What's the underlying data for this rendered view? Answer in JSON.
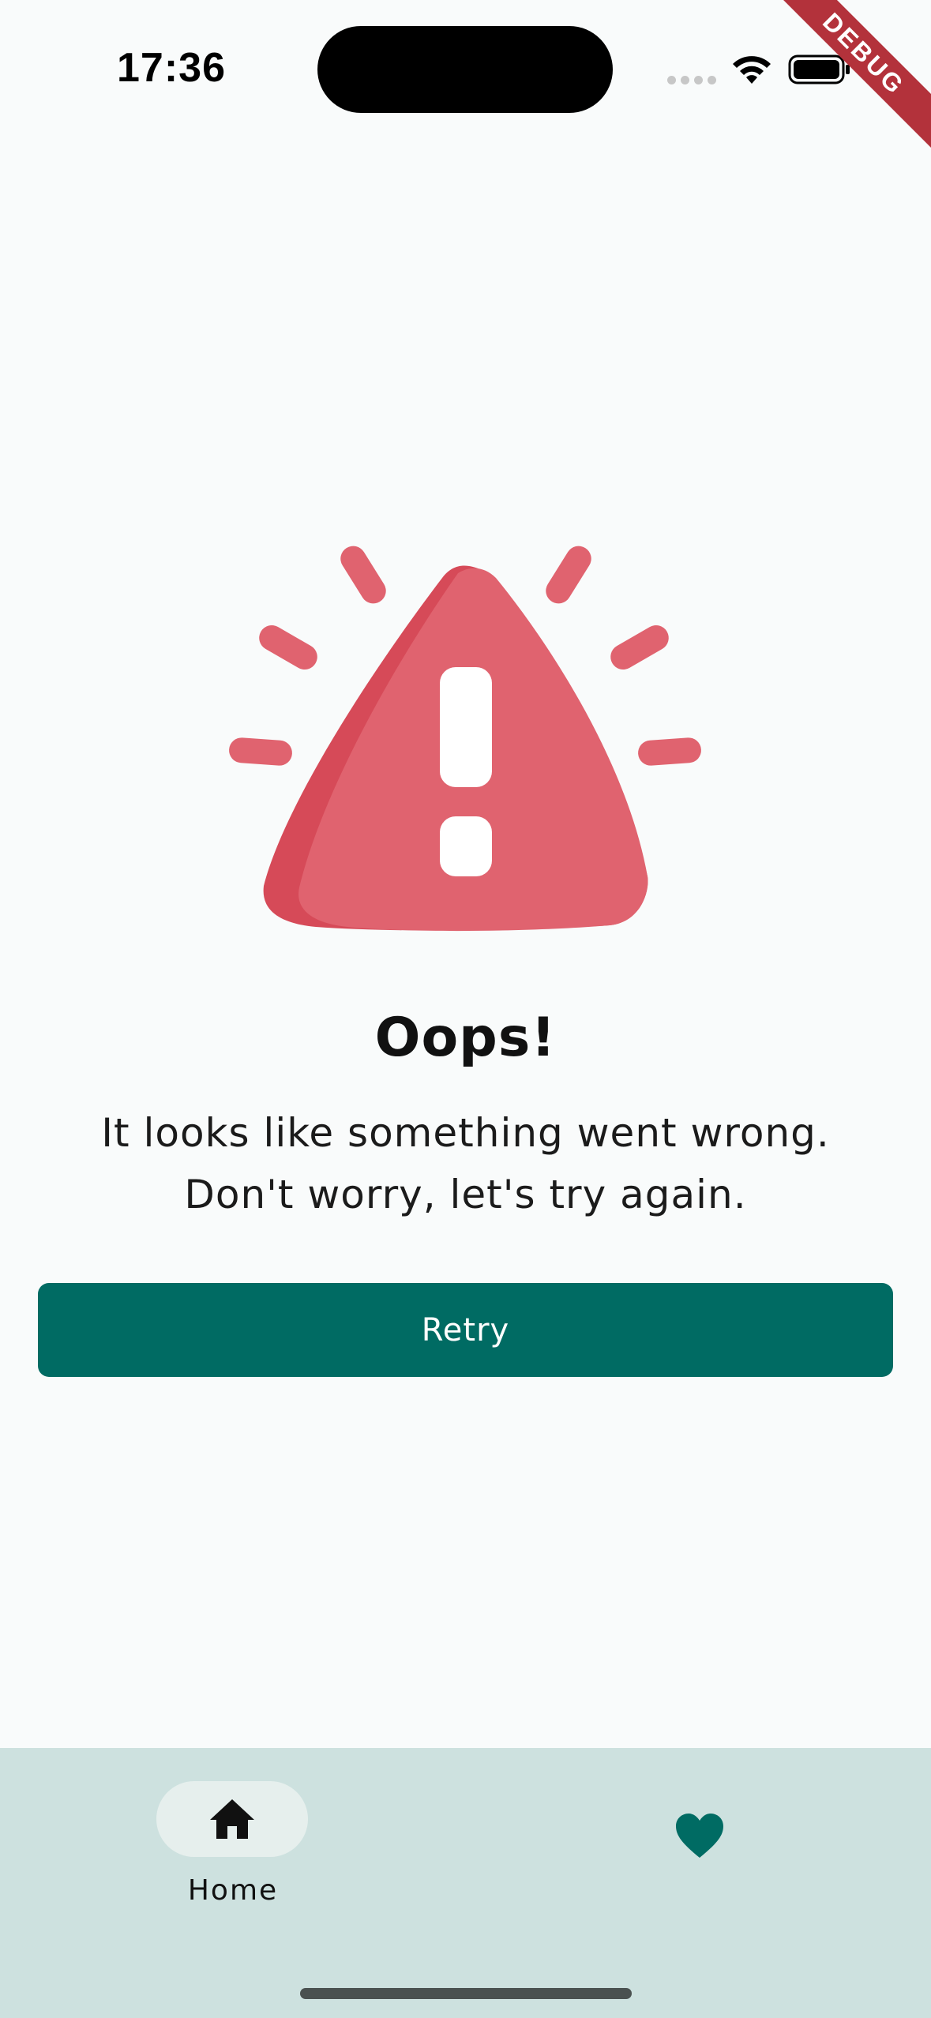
{
  "status_bar": {
    "time": "17:36",
    "icons": [
      "cellular-signal-icon",
      "wifi-icon",
      "battery-icon"
    ]
  },
  "debug_banner": {
    "label": "DEBUG",
    "color": "#b3323b"
  },
  "error_screen": {
    "illustration": "warning-triangle-icon",
    "title": "Oops!",
    "message_line_1": "It looks like something went wrong.",
    "message_line_2": "Don't worry, let's try again.",
    "retry_label": "Retry"
  },
  "bottom_nav": {
    "items": [
      {
        "label": "Home",
        "icon": "home-icon",
        "selected": true
      },
      {
        "label": "",
        "icon": "heart-icon",
        "selected": false
      }
    ]
  },
  "colors": {
    "accent": "#006b63",
    "warning": "#e0636f",
    "nav_background": "#cde1df",
    "page_background": "#f9fbfb"
  }
}
